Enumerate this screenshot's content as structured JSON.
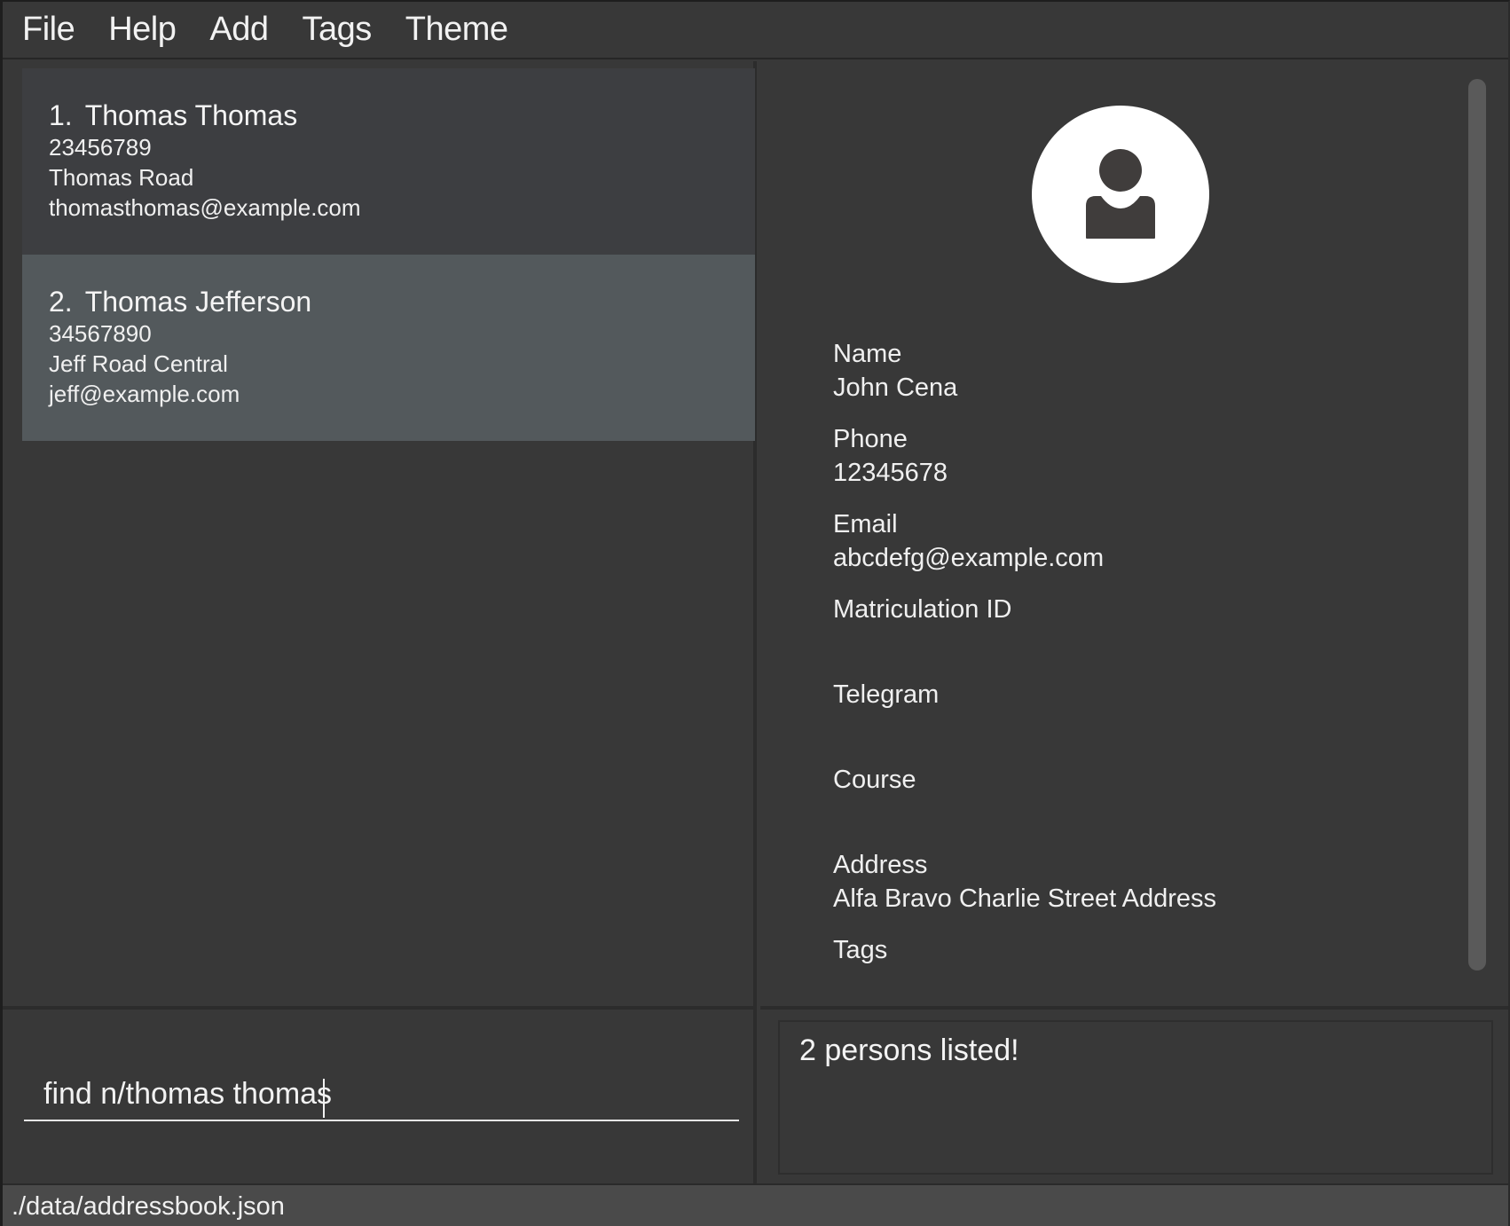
{
  "menu": {
    "items": [
      "File",
      "Help",
      "Add",
      "Tags",
      "Theme"
    ]
  },
  "person_list": [
    {
      "index": "1.",
      "name": "Thomas Thomas",
      "phone": "23456789",
      "address": "Thomas Road",
      "email": "thomasthomas@example.com"
    },
    {
      "index": "2.",
      "name": "Thomas Jefferson",
      "phone": "34567890",
      "address": "Jeff Road Central",
      "email": "jeff@example.com"
    }
  ],
  "detail": {
    "name_label": "Name",
    "name_value": "John Cena",
    "phone_label": "Phone",
    "phone_value": "12345678",
    "email_label": "Email",
    "email_value": "abcdefg@example.com",
    "matric_label": "Matriculation ID",
    "matric_value": "",
    "telegram_label": "Telegram",
    "telegram_value": "",
    "course_label": "Course",
    "course_value": "",
    "address_label": "Address",
    "address_value": "Alfa Bravo Charlie Street Address",
    "tags_label": "Tags"
  },
  "command": {
    "value": "find n/thomas thomas"
  },
  "result": {
    "message": "2 persons listed!"
  },
  "status": {
    "file_path": "./data/addressbook.json"
  },
  "colors": {
    "window_bg": "#383838",
    "selected_card_bg": "#53595c",
    "card_bg": "#3d3e41",
    "text": "#f0f0f0",
    "status_bar_bg": "#4a4a4a"
  },
  "icons": {
    "avatar": "person-avatar-icon"
  }
}
